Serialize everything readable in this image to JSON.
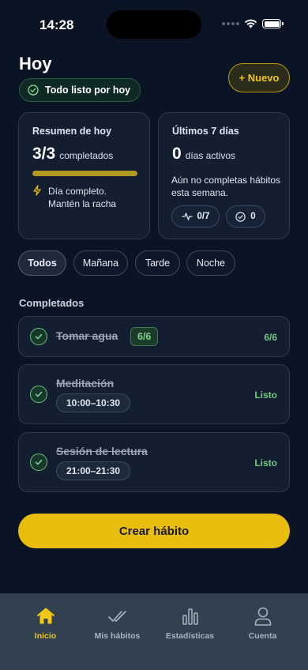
{
  "status_bar": {
    "time": "14:28"
  },
  "header": {
    "title": "Hoy",
    "status_pill": "Todo listo por hoy",
    "new_button": "+ Nuevo"
  },
  "summary_card": {
    "heading": "Resumen de hoy",
    "count": "3/3",
    "unit": "completados",
    "progress": 1.0,
    "note": "Día completo. Mantén la racha"
  },
  "week_card": {
    "heading": "Últimos 7 días",
    "count": "0",
    "unit": "días activos",
    "message": "Aún no completas hábitos esta semana.",
    "days_pill": "0/7",
    "done_pill": "0"
  },
  "filters": [
    {
      "label": "Todos",
      "active": true
    },
    {
      "label": "Mañana",
      "active": false
    },
    {
      "label": "Tarde",
      "active": false
    },
    {
      "label": "Noche",
      "active": false
    }
  ],
  "section_title": "Completados",
  "habits": [
    {
      "name": "Tomar agua",
      "badge": "6/6",
      "status": "6/6"
    },
    {
      "name": "Meditación",
      "time": "10:00–10:30",
      "status": "Listo"
    },
    {
      "name": "Sesión de lectura",
      "time": "21:00–21:30",
      "status": "Listo"
    }
  ],
  "create_button": "Crear hábito",
  "tabs": [
    {
      "label": "Inicio",
      "icon": "home-icon",
      "active": true
    },
    {
      "label": "Mis hábitos",
      "icon": "double-check-icon",
      "active": false
    },
    {
      "label": "Estadísticas",
      "icon": "bar-chart-icon",
      "active": false
    },
    {
      "label": "Cuenta",
      "icon": "user-icon",
      "active": false
    }
  ],
  "colors": {
    "background": "#0a1424",
    "accent": "#e8bd0e",
    "success": "#72c883",
    "tab_bar": "#32414f"
  }
}
